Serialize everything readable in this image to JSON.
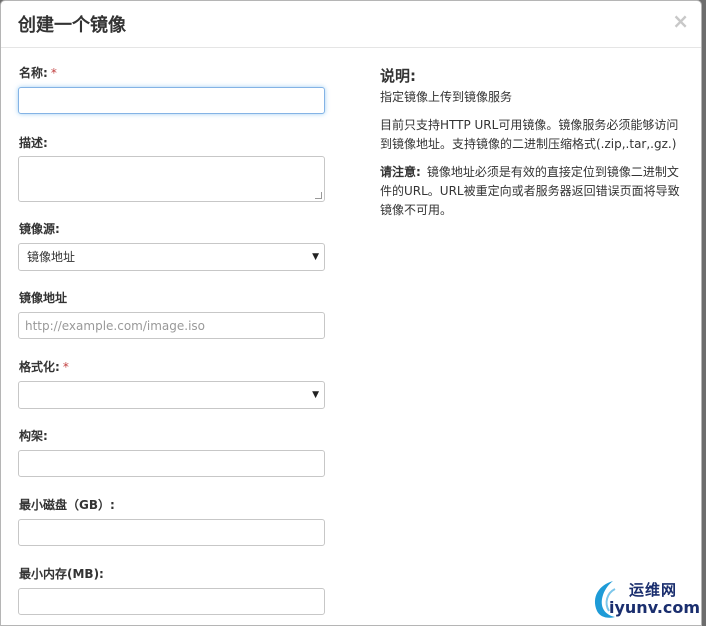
{
  "modal": {
    "title": "创建一个镜像",
    "close_symbol": "×"
  },
  "form": {
    "name": {
      "label": "名称:",
      "required_mark": "*",
      "value": ""
    },
    "description": {
      "label": "描述:",
      "value": ""
    },
    "image_source": {
      "label": "镜像源:",
      "selected": "镜像地址",
      "arrow": "▼"
    },
    "image_location": {
      "label": "镜像地址",
      "placeholder": "http://example.com/image.iso",
      "value": ""
    },
    "format": {
      "label": "格式化:",
      "required_mark": "*",
      "selected": "",
      "arrow": "▼"
    },
    "architecture": {
      "label": "构架:",
      "value": ""
    },
    "min_disk": {
      "label": "最小磁盘（GB）:",
      "value": ""
    },
    "min_ram": {
      "label": "最小内存(MB):",
      "value": ""
    }
  },
  "help": {
    "title": "说明:",
    "line1": "指定镜像上传到镜像服务",
    "line2": "目前只支持HTTP URL可用镜像。镜像服务必须能够访问到镜像地址。支持镜像的二进制压缩格式(.zip,.tar,.gz.)",
    "note_label": "请注意:",
    "note_text": "镜像地址必须是有效的直接定位到镜像二进制文件的URL。URL被重定向或者服务器返回错误页面将导致镜像不可用。"
  },
  "watermark": {
    "top": "运维网",
    "bottom": "iyunv.com"
  },
  "colors": {
    "required": "#c24141",
    "focus_border": "#84b3e5",
    "watermark": "#1a2e6e"
  }
}
